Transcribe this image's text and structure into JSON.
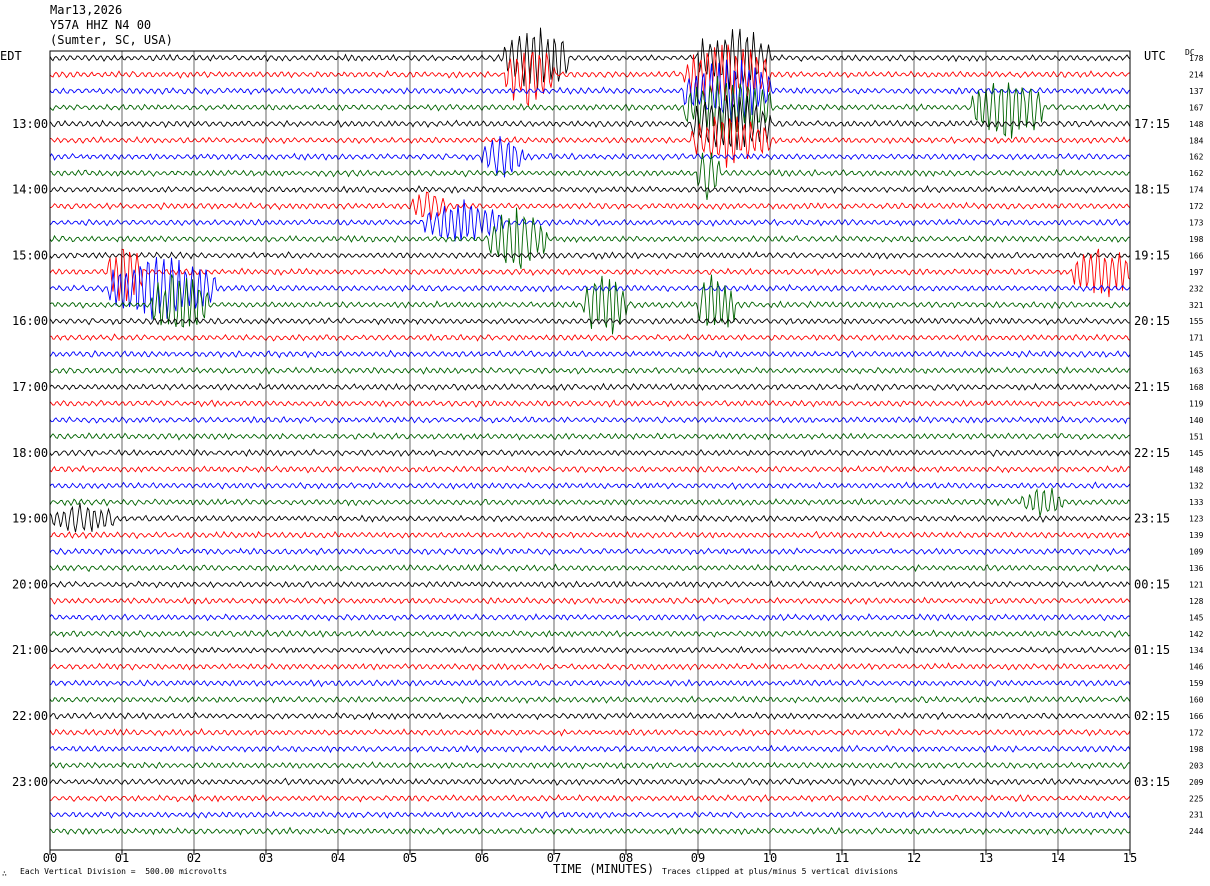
{
  "header": {
    "date": "Mar13,2026",
    "station": "Y57A HHZ N4 00",
    "location": "(Sumter, SC, USA)"
  },
  "left_timezone": "EDT",
  "right_timezone": "UTC",
  "dc_label": "DC",
  "footer": {
    "vertical_division": "Each Vertical Division =  500.00 microvolts",
    "clipping": "Traces clipped at plus/minus 5 vertical divisions",
    "corner_mark": "∴"
  },
  "colors": {
    "trace_cycle": [
      "#000000",
      "#ff0000",
      "#0000ff",
      "#006400"
    ],
    "grid": "#000000",
    "background": "#ffffff"
  },
  "chart_data": {
    "type": "line",
    "title": "Mar13,2026 Y57A HHZ N4 00 (Sumter, SC, USA)",
    "xlabel": "TIME (MINUTES)",
    "ylabel": "",
    "xlim": [
      0,
      15
    ],
    "x_ticks": [
      "00",
      "01",
      "02",
      "03",
      "04",
      "05",
      "06",
      "07",
      "08",
      "09",
      "10",
      "11",
      "12",
      "13",
      "14",
      "15"
    ],
    "grid": true,
    "left_hour_labels": [
      {
        "row": 4,
        "label": "13:00"
      },
      {
        "row": 8,
        "label": "14:00"
      },
      {
        "row": 12,
        "label": "15:00"
      },
      {
        "row": 16,
        "label": "16:00"
      },
      {
        "row": 20,
        "label": "17:00"
      },
      {
        "row": 24,
        "label": "18:00"
      },
      {
        "row": 28,
        "label": "19:00"
      },
      {
        "row": 32,
        "label": "20:00"
      },
      {
        "row": 36,
        "label": "21:00"
      },
      {
        "row": 40,
        "label": "22:00"
      },
      {
        "row": 44,
        "label": "23:00"
      }
    ],
    "right_hour_labels": [
      {
        "row": 0,
        "label": "UTC"
      },
      {
        "row": 4,
        "label": "17:15"
      },
      {
        "row": 8,
        "label": "18:15"
      },
      {
        "row": 12,
        "label": "19:15"
      },
      {
        "row": 16,
        "label": "20:15"
      },
      {
        "row": 20,
        "label": "21:15"
      },
      {
        "row": 24,
        "label": "22:15"
      },
      {
        "row": 28,
        "label": "23:15"
      },
      {
        "row": 32,
        "label": "00:15"
      },
      {
        "row": 36,
        "label": "01:15"
      },
      {
        "row": 40,
        "label": "02:15"
      },
      {
        "row": 44,
        "label": "03:15"
      }
    ],
    "dc_values": [
      178,
      214,
      137,
      167,
      148,
      184,
      162,
      162,
      174,
      172,
      173,
      198,
      166,
      197,
      232,
      321,
      155,
      171,
      145,
      163,
      168,
      119,
      140,
      151,
      145,
      148,
      132,
      133,
      123,
      139,
      109,
      136,
      121,
      128,
      145,
      142,
      134,
      146,
      159,
      160,
      166,
      172,
      198,
      203,
      209,
      225,
      231,
      244
    ],
    "rows": 48,
    "events": [
      {
        "row": 0,
        "start": 6.3,
        "end": 7.2,
        "amp": 5
      },
      {
        "row": 0,
        "start": 9.0,
        "end": 10.0,
        "amp": 5
      },
      {
        "row": 1,
        "start": 6.3,
        "end": 7.0,
        "amp": 5
      },
      {
        "row": 1,
        "start": 8.8,
        "end": 10.0,
        "amp": 5
      },
      {
        "row": 2,
        "start": 8.8,
        "end": 10.0,
        "amp": 5
      },
      {
        "row": 3,
        "start": 8.8,
        "end": 10.0,
        "amp": 5
      },
      {
        "row": 3,
        "start": 12.8,
        "end": 13.8,
        "amp": 5
      },
      {
        "row": 4,
        "start": 8.9,
        "end": 10.0,
        "amp": 5
      },
      {
        "row": 5,
        "start": 8.9,
        "end": 10.0,
        "amp": 4
      },
      {
        "row": 6,
        "start": 6.0,
        "end": 6.6,
        "amp": 3
      },
      {
        "row": 7,
        "start": 9.0,
        "end": 9.3,
        "amp": 4
      },
      {
        "row": 9,
        "start": 5.0,
        "end": 5.5,
        "amp": 2
      },
      {
        "row": 10,
        "start": 5.2,
        "end": 6.3,
        "amp": 3
      },
      {
        "row": 11,
        "start": 6.1,
        "end": 6.9,
        "amp": 5
      },
      {
        "row": 13,
        "start": 0.8,
        "end": 1.3,
        "amp": 5
      },
      {
        "row": 13,
        "start": 14.2,
        "end": 15.0,
        "amp": 4
      },
      {
        "row": 14,
        "start": 0.8,
        "end": 2.3,
        "amp": 5
      },
      {
        "row": 15,
        "start": 1.4,
        "end": 2.2,
        "amp": 5
      },
      {
        "row": 15,
        "start": 7.4,
        "end": 8.0,
        "amp": 5
      },
      {
        "row": 15,
        "start": 9.0,
        "end": 9.5,
        "amp": 5
      },
      {
        "row": 27,
        "start": 13.5,
        "end": 14.1,
        "amp": 2
      },
      {
        "row": 28,
        "start": 0.0,
        "end": 0.9,
        "amp": 2
      }
    ]
  }
}
